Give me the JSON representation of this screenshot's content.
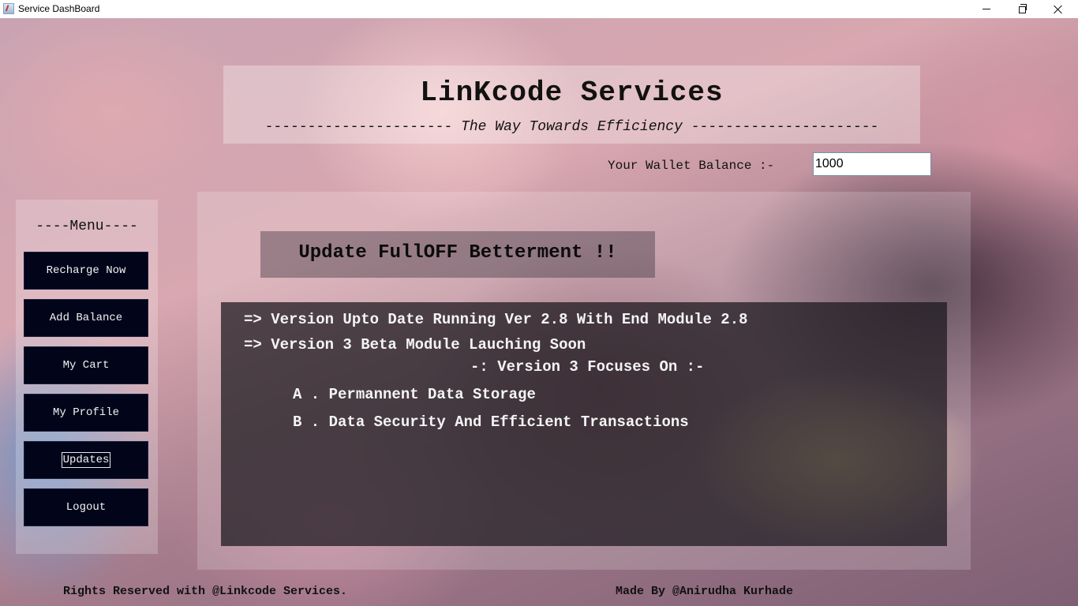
{
  "window": {
    "title": "Service DashBoard",
    "icons": {
      "app": "java-app-icon",
      "minimize": "minimize-icon",
      "maximize": "restore-icon",
      "close": "close-icon"
    }
  },
  "header": {
    "title": "LinKcode Services",
    "tagline_dashes": "----------------------",
    "tagline_phrase": "The Way Towards Efficiency"
  },
  "wallet": {
    "label": "Your Wallet Balance :-",
    "value": "1000"
  },
  "sidebar": {
    "title": "----Menu----",
    "items": [
      {
        "label": "Recharge Now"
      },
      {
        "label": "Add Balance"
      },
      {
        "label": "My Cart"
      },
      {
        "label": "My Profile"
      },
      {
        "label": "Updates",
        "focused": true
      },
      {
        "label": "Logout"
      }
    ]
  },
  "main": {
    "banner": "Update FullOFF Betterment !!",
    "notes": [
      "=> Version Upto Date Running Ver 2.8 With End Module 2.8",
      "=> Version 3 Beta Module Lauching Soon",
      "-: Version 3 Focuses On :-",
      "A . Permannent Data Storage",
      "B . Data Security And Efficient Transactions"
    ]
  },
  "footer": {
    "left": "Rights Reserved with @Linkcode Services.",
    "right": "Made By @Anirudha Kurhade"
  },
  "colors": {
    "button_bg": "#02051a",
    "notes_bg": "rgba(25,22,28,0.72)"
  }
}
